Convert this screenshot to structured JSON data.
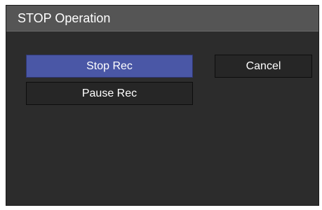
{
  "dialog": {
    "title": "STOP Operation",
    "buttons": {
      "stop_rec": "Stop Rec",
      "pause_rec": "Pause Rec",
      "cancel": "Cancel"
    }
  },
  "colors": {
    "panel_background": "#2c2c2c",
    "title_bar_background": "#555555",
    "primary_button": "#4a57a6",
    "secondary_button": "#262626",
    "text": "#ffffff"
  }
}
